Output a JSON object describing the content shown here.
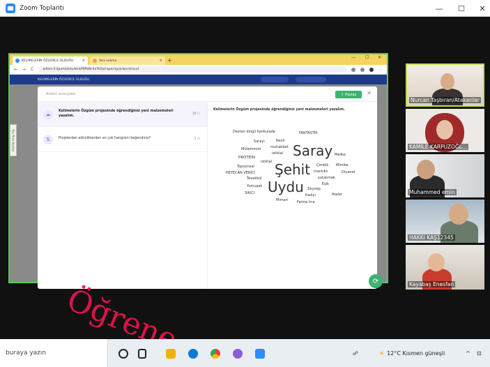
{
  "zoom": {
    "title": "Zoom Toplantı",
    "controls": {
      "minimize": "—",
      "maximize": "☐",
      "close": "✕"
    }
  },
  "browser": {
    "tabs": [
      {
        "label": "KELİMELERİN ÖZGÜRCE OLDUĞU"
      },
      {
        "label": "Yeni sekme"
      }
    ],
    "new_tab": "+",
    "url": "admin.ll.l/portal/student/f9ffd8c4a7b5e/rapor/quiz/wordcloud",
    "site_bar_text": "KELİMELERİN ÖZGÜRCE OLDUĞU",
    "side_tab": "Yüz Yüze Ayarlar"
  },
  "modal": {
    "header": "Anket sonuçları",
    "share_label": "Paylaş",
    "close": "✕",
    "questions": [
      {
        "text": "Kelimelerin Özgüm projesinde öğrendiğiniz yeni malzemeleri yazalım.",
        "count": "10  ⚇",
        "active": true,
        "icon": "☁"
      },
      {
        "text": "Projelerden etkinliklerden en çok hangisini beğendiniz?",
        "count": "1  ⚇",
        "active": false,
        "icon": "⇅"
      }
    ],
    "result_title": "Kelimelerin Özgüm projesinde öğrendiğiniz yeni malzemeleri yazalım.",
    "words": [
      "Destan dingil harikulade",
      "FANTASTİK",
      "Sarayı",
      "Nezil",
      "Mütemmim",
      "muhabbet",
      "istiklal",
      "Saray",
      "Melike",
      "PROTEIN",
      "istiklal",
      "Toplumsal",
      "Şehit",
      "Çimbik",
      "Mimike",
      "HEYECAN VERİCİ",
      "mantıklı",
      "Diyanet",
      "Tevekkül",
      "yatakmak",
      "Eşik",
      "Yumuşak",
      "Uydu",
      "Zeynep",
      "SIKICI",
      "Kadıçı",
      "Ataler",
      "Mimari",
      "Fatma İrra"
    ]
  },
  "participants": [
    {
      "name": "Nurcan Taşbıran/Atakanlar"
    },
    {
      "name": "KAMİLE KARPUZOĞL..."
    },
    {
      "name": "Muhammed emin"
    },
    {
      "name": "HAKKI KAŞ12345"
    },
    {
      "name": "Kayabaş Enesfan"
    }
  ],
  "watermark": {
    "text": "Öğrene"
  },
  "taskbar": {
    "search_placeholder": "buraya yazın",
    "weather": "12°C  Kısmen güneşli",
    "tray_chevron": "^"
  },
  "colors": {
    "share_green": "#3cb371",
    "speaking_border": "#b9e34d",
    "watermark_red": "#e8144c",
    "tab_bar": "#f4d35e",
    "site_navy": "#1e3a8a"
  }
}
